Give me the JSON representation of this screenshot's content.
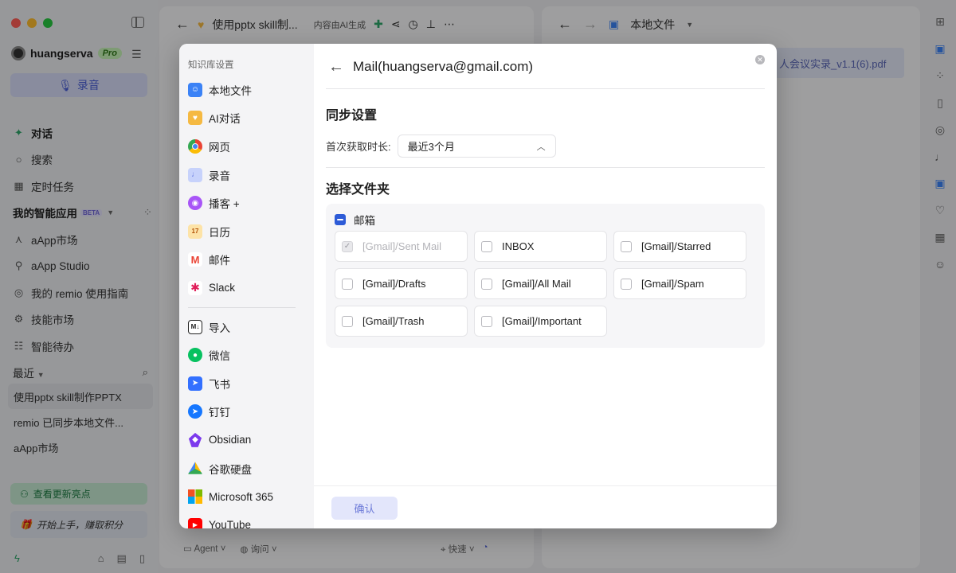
{
  "sidebar": {
    "username": "huangserva",
    "plan_badge": "Pro",
    "record_label": "录音",
    "nav": [
      {
        "label": "对话",
        "icon": "chat-spark-icon",
        "bold": true
      },
      {
        "label": "搜索",
        "icon": "search-icon",
        "bold": false
      },
      {
        "label": "定时任务",
        "icon": "calendar-icon",
        "bold": false
      }
    ],
    "apps_header": "我的智能应用",
    "beta_label": "BETA",
    "apps": [
      {
        "label": "aApp市场",
        "icon": "wand-icon"
      },
      {
        "label": "aApp Studio",
        "icon": "wrench-icon"
      },
      {
        "label": "我的 remio 使用指南",
        "icon": "compass-icon"
      },
      {
        "label": "技能市场",
        "icon": "skill-icon"
      },
      {
        "label": "智能待办",
        "icon": "todo-icon"
      }
    ],
    "recent_header": "最近",
    "recent": [
      {
        "label": "使用pptx skill制作PPTX",
        "active": true
      },
      {
        "label": "remio 已同步本地文件...",
        "active": false
      },
      {
        "label": "aApp市场",
        "active": false
      }
    ],
    "update_label": "查看更新亮点",
    "start_label": "开始上手，赚取积分"
  },
  "middle_panel": {
    "title": "使用pptx skill制...",
    "ai_note": "内容由AI生成",
    "bottom": {
      "agent": "Agent",
      "ask": "询问",
      "speed": "快速"
    }
  },
  "right_panel": {
    "title": "本地文件",
    "file_name": "人会议实录_v1.1(6).pdf"
  },
  "modal": {
    "left_title": "知识库设置",
    "sources_primary": [
      {
        "label": "本地文件",
        "icon": "finder-icon",
        "color": "#3b82f6"
      },
      {
        "label": "AI对话",
        "icon": "ai-heart-icon",
        "color": "#f5b942"
      },
      {
        "label": "网页",
        "icon": "chrome-icon",
        "color": "#ea4335"
      },
      {
        "label": "录音",
        "icon": "mic-icon",
        "color": "#8aa4f5"
      },
      {
        "label": "播客 +",
        "icon": "podcast-icon",
        "color": "#a855f7"
      },
      {
        "label": "日历",
        "icon": "calendar-icon",
        "color": "#f59e0b"
      },
      {
        "label": "邮件",
        "icon": "gmail-icon",
        "color": "#ea4335"
      },
      {
        "label": "Slack",
        "icon": "slack-icon",
        "color": "#4a154b"
      }
    ],
    "sources_secondary": [
      {
        "label": "导入",
        "icon": "markdown-icon",
        "color": "#222222"
      },
      {
        "label": "微信",
        "icon": "wechat-icon",
        "color": "#07c160"
      },
      {
        "label": "飞书",
        "icon": "feishu-icon",
        "color": "#3370ff"
      },
      {
        "label": "钉钉",
        "icon": "dingtalk-icon",
        "color": "#1677ff"
      },
      {
        "label": "Obsidian",
        "icon": "obsidian-icon",
        "color": "#7c3aed"
      },
      {
        "label": "谷歌硬盘",
        "icon": "gdrive-icon",
        "color": "#34a853"
      },
      {
        "label": "Microsoft 365",
        "icon": "microsoft-icon",
        "color": "#f25022"
      },
      {
        "label": "YouTube",
        "icon": "youtube-icon",
        "color": "#ff0000"
      }
    ],
    "title": "Mail(huangserva@gmail.com)",
    "sync_heading": "同步设置",
    "duration_label": "首次获取时长:",
    "duration_value": "最近3个月",
    "folder_heading": "选择文件夹",
    "mailbox_label": "邮箱",
    "folders": [
      {
        "label": "[Gmail]/Sent Mail",
        "state": "disabled-checked"
      },
      {
        "label": "INBOX",
        "state": "unchecked"
      },
      {
        "label": "[Gmail]/Starred",
        "state": "unchecked"
      },
      {
        "label": "[Gmail]/Drafts",
        "state": "unchecked"
      },
      {
        "label": "[Gmail]/All Mail",
        "state": "unchecked"
      },
      {
        "label": "[Gmail]/Spam",
        "state": "unchecked"
      },
      {
        "label": "[Gmail]/Trash",
        "state": "unchecked"
      },
      {
        "label": "[Gmail]/Important",
        "state": "unchecked"
      }
    ],
    "confirm_label": "确认"
  }
}
